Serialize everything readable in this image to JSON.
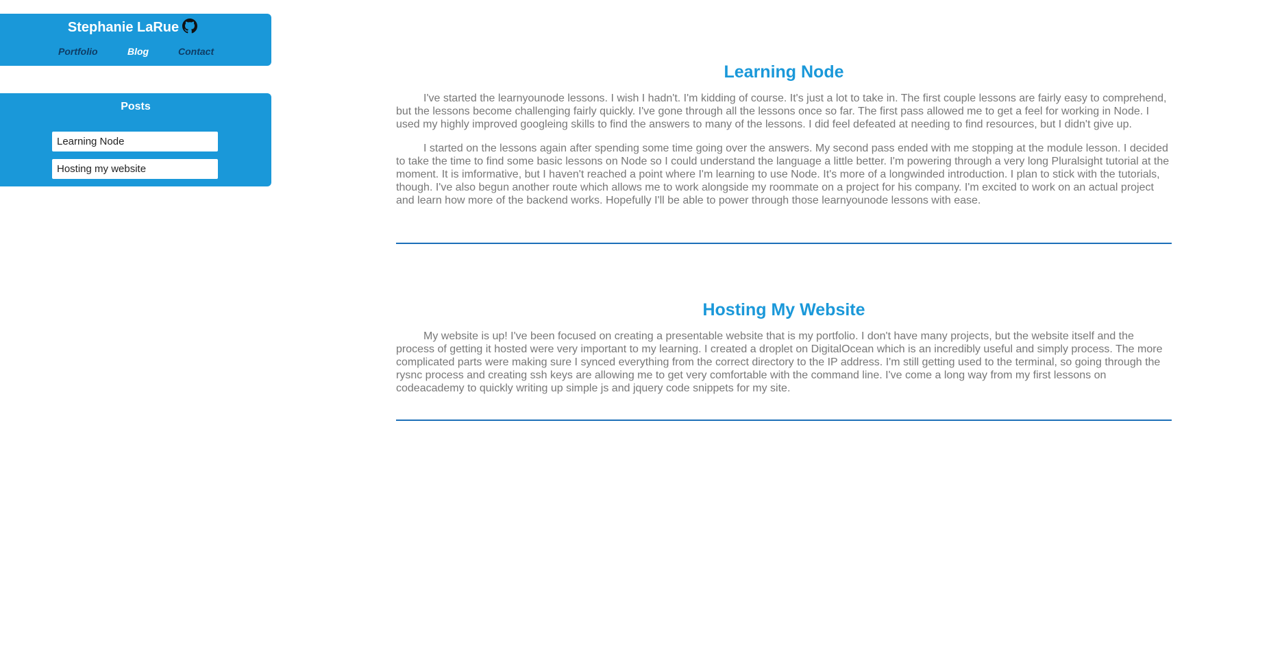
{
  "header": {
    "site_title": "Stephanie LaRue",
    "github_icon": "github-icon",
    "nav": {
      "portfolio": "Portfolio",
      "blog": "Blog",
      "contact": "Contact"
    }
  },
  "sidebar": {
    "posts_title": "Posts",
    "posts": [
      {
        "label": "Learning Node"
      },
      {
        "label": "Hosting my website"
      }
    ]
  },
  "articles": [
    {
      "title": "Learning Node",
      "paragraphs": [
        "I've started the learnyounode lessons. I wish I hadn't. I'm kidding of course. It's just a lot to take in. The first couple lessons are fairly easy to comprehend, but the lessons become challenging fairly quickly. I've gone through all the lessons once so far. The first pass allowed me to get a feel for working in Node. I used my highly improved googleing skills to find the answers to many of the lessons. I did feel defeated at needing to find resources, but I didn't give up.",
        "I started on the lessons again after spending some time going over the answers. My second pass ended with me stopping at the module lesson. I decided to take the time to find some basic lessons on Node so I could understand the language a little better. I'm powering through a very long Pluralsight tutorial at the moment. It is imformative, but I haven't reached a point where I'm learning to use Node. It's more of a longwinded introduction. I plan to stick with the tutorials, though. I've also begun another route which allows me to work alongside my roommate on a project for his company. I'm excited to work on an actual project and learn how more of the backend works. Hopefully I'll be able to power through those learnyounode lessons with ease."
      ]
    },
    {
      "title": "Hosting My Website",
      "paragraphs": [
        "My website is up! I've been focused on creating a presentable website that is my portfolio. I don't have many projects, but the website itself and the process of getting it hosted were very important to my learning. I created a droplet on DigitalOcean which is an incredibly useful and simply process. The more complicated parts were making sure I synced everything from the correct directory to the IP address. I'm still getting used to the terminal, so going through the rysnc process and creating ssh keys are allowing me to get very comfortable with the command line. I've come a long way from my first lessons on codeacademy to quickly writing up simple js and jquery code snippets for my site."
      ]
    }
  ],
  "colors": {
    "accent": "#1a98d9",
    "nav_dark": "#0e3d66",
    "body_text": "#777777",
    "divider": "#1c6fb8"
  }
}
